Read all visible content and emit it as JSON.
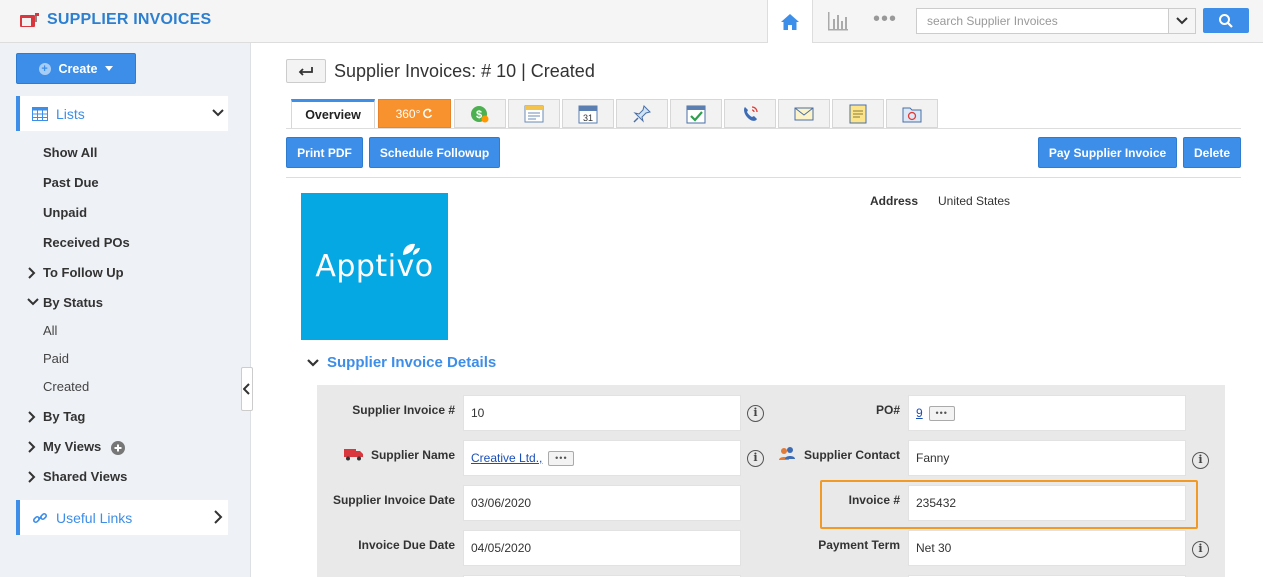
{
  "header": {
    "app_title": "SUPPLIER INVOICES",
    "search_placeholder": "search Supplier Invoices",
    "more_label": "•••"
  },
  "sidebar": {
    "create_label": "Create",
    "lists_label": "Lists",
    "items": {
      "show_all": "Show All",
      "past_due": "Past Due",
      "unpaid": "Unpaid",
      "received_pos": "Received POs",
      "to_follow_up": "To Follow Up",
      "by_status": "By Status",
      "status_all": "All",
      "status_paid": "Paid",
      "status_created": "Created",
      "by_tag": "By Tag",
      "my_views": "My Views",
      "shared_views": "Shared Views"
    },
    "useful_links_label": "Useful Links"
  },
  "page": {
    "title": "Supplier Invoices: # 10 | Created"
  },
  "tabs": {
    "overview": "Overview",
    "tab_360": "360°"
  },
  "actions": {
    "print_pdf": "Print PDF",
    "schedule_followup": "Schedule Followup",
    "pay_supplier_invoice": "Pay Supplier Invoice",
    "delete": "Delete"
  },
  "logo": {
    "text": "Apptivo"
  },
  "address": {
    "label": "Address",
    "value": "United States"
  },
  "details": {
    "section_title": "Supplier Invoice Details",
    "supplier_invoice_no_label": "Supplier Invoice #",
    "supplier_invoice_no_value": "10",
    "po_label": "PO#",
    "po_value": "9",
    "supplier_name_label": "Supplier Name",
    "supplier_name_value": "Creative Ltd.,",
    "supplier_contact_label": "Supplier Contact",
    "supplier_contact_value": "Fanny",
    "invoice_date_label": "Supplier Invoice Date",
    "invoice_date_value": "03/06/2020",
    "invoice_no_label": "Invoice #",
    "invoice_no_value": "235432",
    "due_date_label": "Invoice Due Date",
    "due_date_value": "04/05/2020",
    "payment_term_label": "Payment Term",
    "payment_term_value": "Net 30"
  },
  "colors": {
    "accent": "#3d8ee8",
    "tab_360": "#f7922e",
    "logo_bg": "#06a8e4",
    "highlight": "#f29a26"
  }
}
